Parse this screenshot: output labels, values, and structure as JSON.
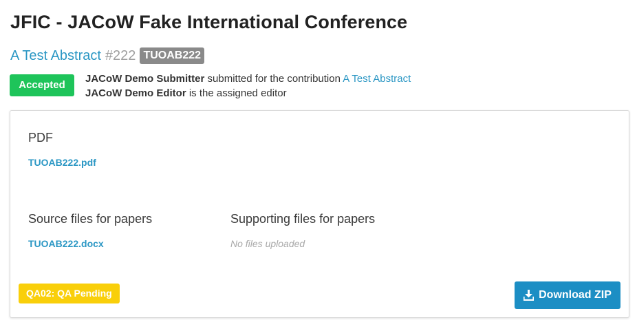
{
  "conference": {
    "title": "JFIC - JACoW Fake International Conference"
  },
  "contribution": {
    "title": "A Test Abstract",
    "number": "#222",
    "code": "TUOAB222"
  },
  "status": {
    "badge": "Accepted",
    "badge_color": "#1ec45a",
    "submitter_name": "JACoW Demo Submitter",
    "submitter_text": " submitted for the contribution ",
    "contribution_link": "A Test Abstract",
    "editor_name": "JACoW Demo Editor",
    "editor_text": " is the assigned editor"
  },
  "files": {
    "pdf": {
      "heading": "PDF",
      "file": "TUOAB222.pdf"
    },
    "source": {
      "heading": "Source files for papers",
      "file": "TUOAB222.docx"
    },
    "supporting": {
      "heading": "Supporting files for papers",
      "empty": "No files uploaded"
    }
  },
  "qa": {
    "badge": "QA02: QA Pending",
    "badge_color": "#f9cf0a"
  },
  "actions": {
    "download_label": "Download ZIP",
    "download_icon": "download-icon",
    "accent_color": "#1c8ec4"
  }
}
